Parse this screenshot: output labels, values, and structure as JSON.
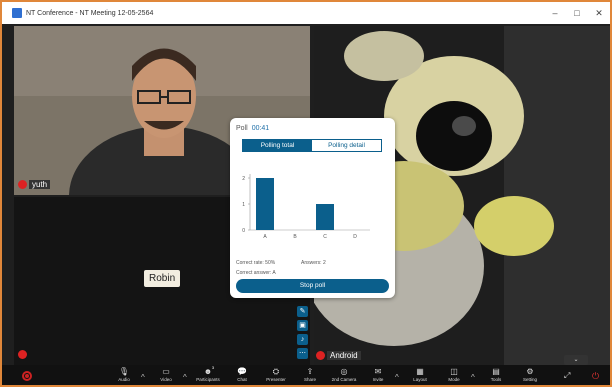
{
  "window": {
    "title": "NT Conference - NT Meeting 12-05-2564",
    "controls": [
      "–",
      "□",
      "✕"
    ]
  },
  "participants": {
    "yuth": {
      "name": "yuth"
    },
    "android": {
      "name": "Android"
    },
    "robin": {
      "name": "Robin"
    }
  },
  "poll": {
    "title": "Poll",
    "time": "00:41",
    "tabs": [
      "Polling total",
      "Polling detail"
    ],
    "correct_rate": "Correct rate: 50%",
    "answers": "Answers: 2",
    "correct_answer": "Correct answer: A",
    "stop_label": "Stop poll"
  },
  "chart_data": {
    "type": "bar",
    "categories": [
      "A",
      "B",
      "C",
      "D"
    ],
    "values": [
      2,
      0,
      1,
      0
    ],
    "ylim": [
      0,
      2
    ],
    "yticks": [
      "0",
      "1",
      "2"
    ],
    "bar_color": "#0b5f8c"
  },
  "toolbar": {
    "items": [
      {
        "label": "Audio",
        "icon": "mic-icon"
      },
      {
        "label": "Video",
        "icon": "video-icon"
      },
      {
        "label": "Participants",
        "icon": "participants-icon",
        "count": "3"
      },
      {
        "label": "Chat",
        "icon": "chat-icon"
      },
      {
        "label": "Presenter",
        "icon": "presenter-icon"
      },
      {
        "label": "Share",
        "icon": "share-icon"
      },
      {
        "label": "2nd Camera",
        "icon": "camera-icon"
      },
      {
        "label": "Invite",
        "icon": "invite-icon"
      },
      {
        "label": "Layout",
        "icon": "layout-icon"
      },
      {
        "label": "Mode",
        "icon": "mode-icon"
      },
      {
        "label": "Tools",
        "icon": "tools-icon"
      },
      {
        "label": "Setting",
        "icon": "gear-icon"
      }
    ]
  }
}
